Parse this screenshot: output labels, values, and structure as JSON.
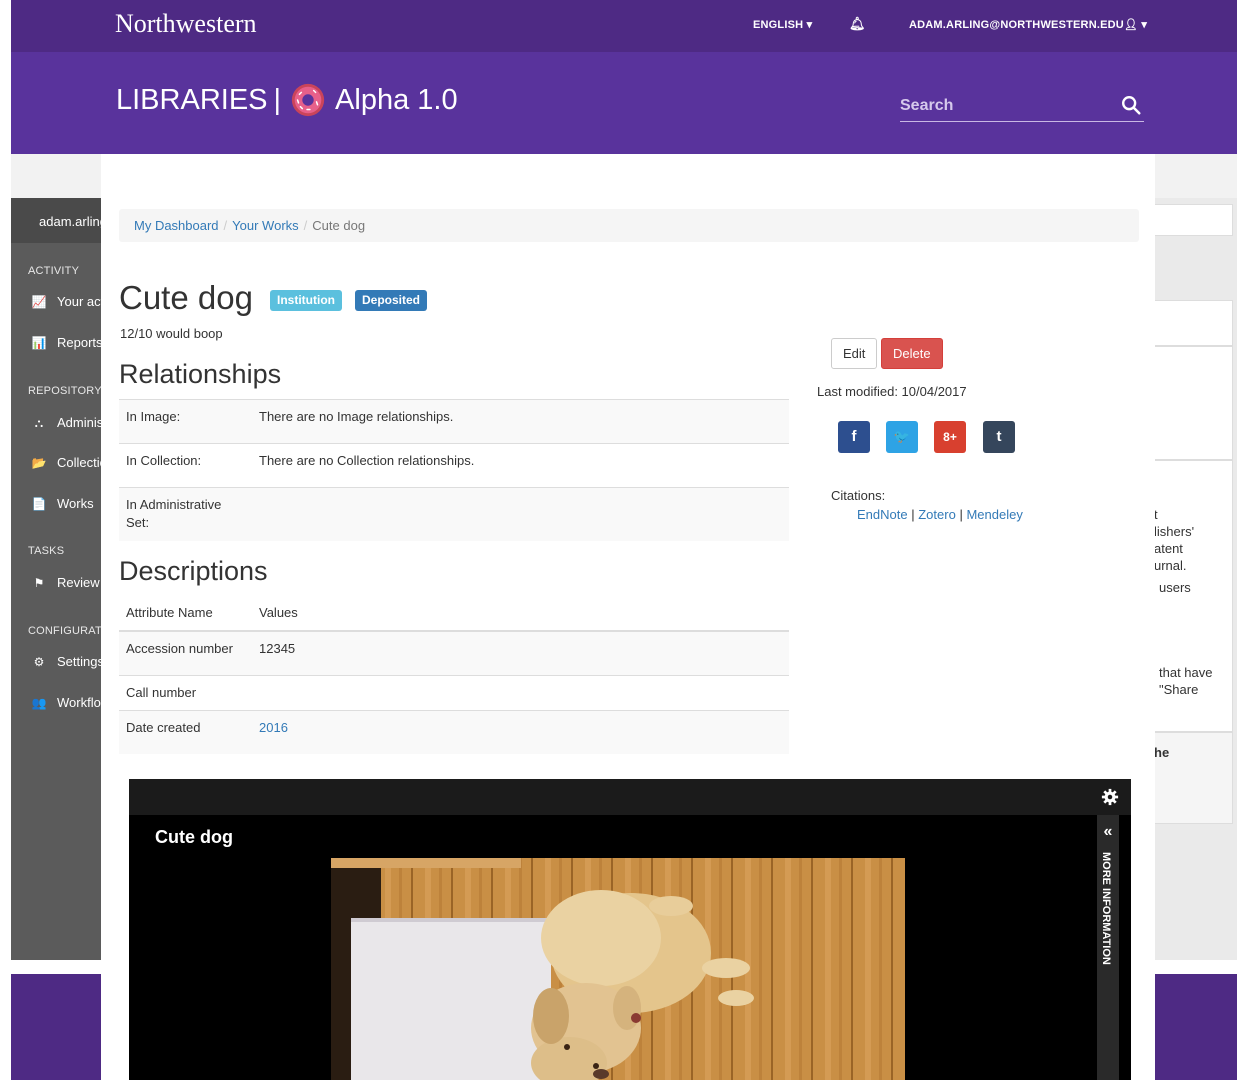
{
  "background": {
    "user": "adam.arling",
    "sections": [
      "ACTIVITY",
      "REPOSITORY CONTENTS",
      "TASKS",
      "CONFIGURATION"
    ],
    "items": [
      "Your activity",
      "Reports",
      "Administrative Sets",
      "Collections",
      "Works",
      "Review Submissions",
      "Settings",
      "Workflow Roles"
    ],
    "right_texts": [
      "t",
      "lishers'",
      "atent",
      "urnal.",
      "users",
      "that have",
      "\"Share",
      "he"
    ]
  },
  "header": {
    "brand": "Northwestern",
    "language": "ENGLISH",
    "user_email": "ADAM.ARLING@NORTHWESTERN.EDU"
  },
  "banner": {
    "libraries": "LIBRARIES",
    "separator": "|",
    "app_name": "Alpha 1.0"
  },
  "search": {
    "placeholder": "Search"
  },
  "breadcrumb": [
    "My Dashboard",
    "Your Works",
    "Cute dog"
  ],
  "work": {
    "title": "Cute dog",
    "badges": [
      "Institution",
      "Deposited"
    ],
    "subtitle": "12/10 would boop"
  },
  "relationships": {
    "heading": "Relationships",
    "rows": [
      {
        "label": "In Image:",
        "value": "There are no Image relationships."
      },
      {
        "label": "In Collection:",
        "value": "There are no Collection relationships."
      },
      {
        "label": "In Administrative Set:",
        "value": ""
      }
    ]
  },
  "descriptions": {
    "heading": "Descriptions",
    "header": {
      "name": "Attribute Name",
      "values": "Values"
    },
    "rows": [
      {
        "label": "Accession number",
        "value": "12345"
      },
      {
        "label": "Call number",
        "value": ""
      },
      {
        "label": "Date created",
        "value": "2016"
      }
    ]
  },
  "actions": {
    "edit": "Edit",
    "delete": "Delete",
    "last_modified": "Last modified: 10/04/2017"
  },
  "share": [
    {
      "name": "facebook",
      "glyph": "f",
      "color": "#2d4f8f"
    },
    {
      "name": "twitter",
      "glyph": "🐦",
      "color": "#2ea3e5"
    },
    {
      "name": "google-plus",
      "glyph": "8+",
      "color": "#d8402f"
    },
    {
      "name": "tumblr",
      "glyph": "t",
      "color": "#35465c"
    }
  ],
  "citations": {
    "label": "Citations:",
    "links": [
      "EndNote",
      "Zotero",
      "Mendeley"
    ],
    "separator": "|"
  },
  "viewer": {
    "title": "Cute dog",
    "side_label": "MORE INFORMATION",
    "collapse_glyph": "«"
  },
  "colors": {
    "brand_purple": "#4e2a84",
    "banner_purple": "#59339c",
    "institution_badge": "#5bc0de",
    "deposited_badge": "#337ab7",
    "delete_red": "#d9534f"
  }
}
